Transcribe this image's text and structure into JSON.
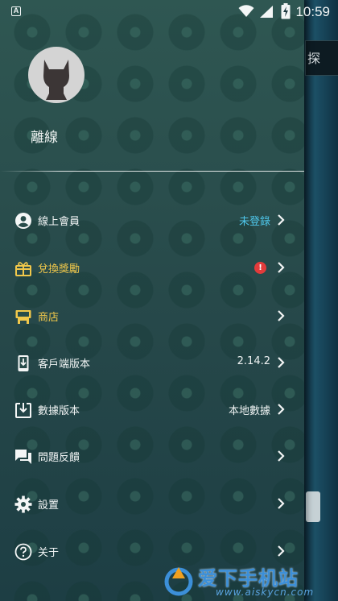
{
  "statusbar": {
    "notification_glyph": "A",
    "time": "10:59"
  },
  "profile": {
    "name": "離線"
  },
  "menu": [
    {
      "id": "online-member",
      "label": "線上會員",
      "value": "未登錄",
      "icon": "account-circle-icon"
    },
    {
      "id": "redeem-rewards",
      "label": "兌換獎勵",
      "value": "",
      "badge": "!",
      "icon": "gift-icon"
    },
    {
      "id": "store",
      "label": "商店",
      "value": "",
      "icon": "store-icon"
    },
    {
      "id": "client-version",
      "label": "客戶端版本",
      "value": "2.14.2",
      "icon": "phone-download-icon"
    },
    {
      "id": "data-version",
      "label": "數據版本",
      "value": "本地數據",
      "icon": "download-box-icon"
    },
    {
      "id": "feedback",
      "label": "問題反饋",
      "value": "",
      "icon": "chat-icon"
    },
    {
      "id": "settings",
      "label": "設置",
      "value": "",
      "icon": "gear-icon"
    },
    {
      "id": "about",
      "label": "关于",
      "value": "",
      "icon": "help-circle-icon"
    }
  ],
  "background": {
    "cut_button_glyph": "探"
  },
  "watermark": {
    "title": "爱下手机站",
    "url": "www.aiskycn.com"
  },
  "colors": {
    "accent_link": "#4ec6ea",
    "gold": "#f1c84b",
    "badge_red": "#e23b3b"
  }
}
